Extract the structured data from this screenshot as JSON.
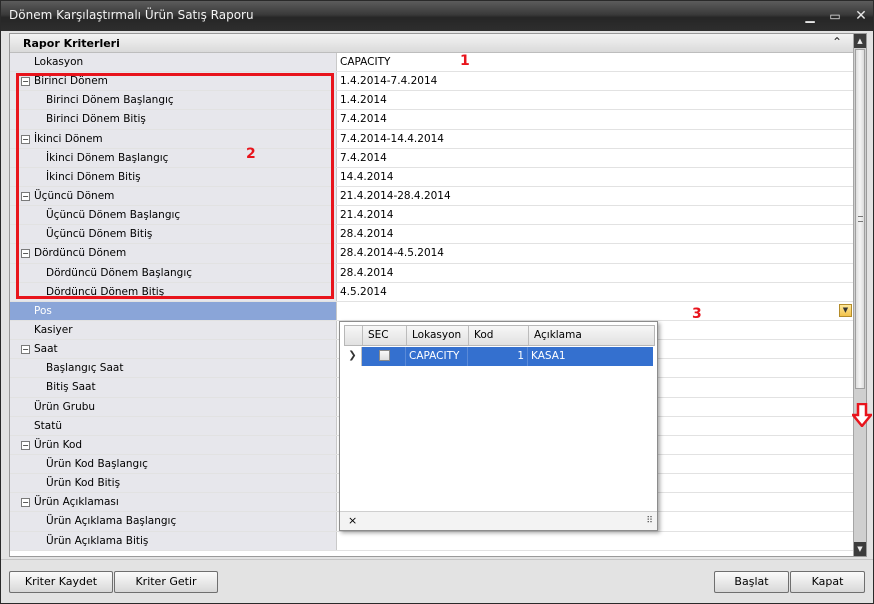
{
  "window": {
    "title": "Dönem Karşılaştırmalı Ürün Satış Raporu"
  },
  "category": {
    "label": "Rapor Kriterleri"
  },
  "rows": [
    {
      "type": "l0",
      "name": "Lokasyon",
      "value": "CAPACITY"
    },
    {
      "type": "group",
      "name": "Birinci Dönem",
      "value": "1.4.2014-7.4.2014"
    },
    {
      "type": "l1",
      "name": "Birinci Dönem Başlangıç",
      "value": "1.4.2014"
    },
    {
      "type": "l1",
      "name": "Birinci Dönem Bitiş",
      "value": "7.4.2014"
    },
    {
      "type": "group",
      "name": "İkinci Dönem",
      "value": "7.4.2014-14.4.2014"
    },
    {
      "type": "l1",
      "name": "İkinci Dönem Başlangıç",
      "value": "7.4.2014"
    },
    {
      "type": "l1",
      "name": "İkinci Dönem Bitiş",
      "value": "14.4.2014"
    },
    {
      "type": "group",
      "name": "Üçüncü Dönem",
      "value": "21.4.2014-28.4.2014"
    },
    {
      "type": "l1",
      "name": "Üçüncü Dönem Başlangıç",
      "value": "21.4.2014"
    },
    {
      "type": "l1",
      "name": "Üçüncü Dönem Bitiş",
      "value": "28.4.2014"
    },
    {
      "type": "group",
      "name": "Dördüncü Dönem",
      "value": "28.4.2014-4.5.2014"
    },
    {
      "type": "l1",
      "name": "Dördüncü Dönem Başlangıç",
      "value": "28.4.2014"
    },
    {
      "type": "l1",
      "name": "Dördüncü Dönem Bitiş",
      "value": "4.5.2014"
    },
    {
      "type": "l0",
      "name": "Pos",
      "value": "",
      "selected": true
    },
    {
      "type": "l0",
      "name": "Kasiyer",
      "value": ""
    },
    {
      "type": "group",
      "name": "Saat",
      "value": ""
    },
    {
      "type": "l1",
      "name": "Başlangıç Saat",
      "value": ""
    },
    {
      "type": "l1",
      "name": "Bitiş Saat",
      "value": ""
    },
    {
      "type": "l0",
      "name": "Ürün Grubu",
      "value": ""
    },
    {
      "type": "l0",
      "name": "Statü",
      "value": ""
    },
    {
      "type": "group",
      "name": "Ürün Kod",
      "value": ""
    },
    {
      "type": "l1",
      "name": "Ürün Kod Başlangıç",
      "value": ""
    },
    {
      "type": "l1",
      "name": "Ürün Kod Bitiş",
      "value": ""
    },
    {
      "type": "group",
      "name": "Ürün Açıklaması",
      "value": ""
    },
    {
      "type": "l1",
      "name": "Ürün Açıklama Başlangıç",
      "value": ""
    },
    {
      "type": "l1",
      "name": "Ürün Açıklama Bitiş",
      "value": ""
    }
  ],
  "popup": {
    "columns": [
      "SEC",
      "Lokasyon",
      "Kod",
      "Açıklama"
    ],
    "row": {
      "lokasyon": "CAPACITY",
      "kod": "1",
      "aciklama": "KASA1"
    },
    "close_label": "×"
  },
  "annotations": {
    "a1": "1",
    "a2": "2",
    "a3": "3"
  },
  "buttons": {
    "kaydet": "Kriter Kaydet",
    "getir": "Kriter Getir",
    "baslat": "Başlat",
    "kapat": "Kapat"
  },
  "colors": {
    "accent": "#3470cf",
    "annotation": "#e8141c",
    "selected_row": "#8aa5d8"
  }
}
